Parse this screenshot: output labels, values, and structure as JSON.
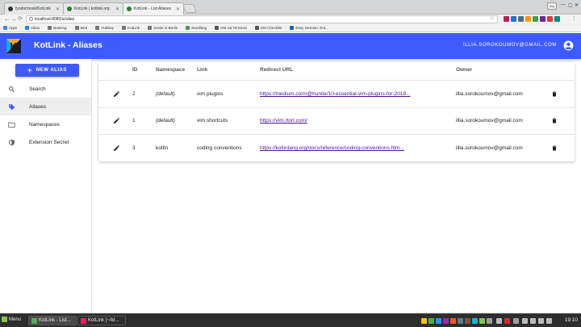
{
  "browser": {
    "tabs": [
      {
        "title": "fyodormosk/KotLink"
      },
      {
        "title": "KotLink | kotlink.org"
      },
      {
        "title": "KotLink - List Aliases"
      }
    ],
    "url": "localhost:8080/ui/alias",
    "user_chip": "Illia",
    "bookmarks": [
      {
        "label": "Apps"
      },
      {
        "label": "Inbox"
      },
      {
        "label": "Banking"
      },
      {
        "label": "Med"
      },
      {
        "label": "Yubikey"
      },
      {
        "label": "KotLink"
      },
      {
        "label": "Sextie in Berlin"
      },
      {
        "label": "Seedlang"
      },
      {
        "label": "GM via Terminal"
      },
      {
        "label": "GM Checklist"
      },
      {
        "label": "Easy German: Ent..."
      }
    ]
  },
  "app": {
    "title": "KotLink - Aliases",
    "user_email": "ILLIA.SOROKOUMOV@GMAIL.COM",
    "new_alias_label": "NEW ALIAS",
    "nav": [
      {
        "label": "Search",
        "icon": "search-icon"
      },
      {
        "label": "Aliases",
        "icon": "label-icon"
      },
      {
        "label": "Namespaces",
        "icon": "folder-icon"
      },
      {
        "label": "Extension Secret",
        "icon": "security-icon"
      }
    ],
    "accent_color": "#3d5afe"
  },
  "table": {
    "columns": {
      "id": "ID",
      "namespace": "Namespace",
      "link": "Link",
      "redirect": "Redirect URL",
      "owner": "Owner"
    },
    "rows": [
      {
        "id": "2",
        "namespace": "(default)",
        "link": "vim plugins",
        "redirect": "https://medium.com/@huntie/10-essential-vim-plugins-for-2018...",
        "owner": "illia.sorokoumov@gmail.com"
      },
      {
        "id": "1",
        "namespace": "(default)",
        "link": "vim shortcuts",
        "redirect": "https://vim.rtorr.com/",
        "owner": "illia.sorokoumov@gmail.com"
      },
      {
        "id": "3",
        "namespace": "kotlin",
        "link": "coding conventions",
        "redirect": "https://kotlinlang.org/docs/reference/coding-conventions.htm...",
        "owner": "illia.sorokoumov@gmail.com"
      }
    ]
  },
  "taskbar": {
    "menu_label": "Menu",
    "windows": [
      {
        "label": "KotLink - List..."
      },
      {
        "label": "KotLink [~/Id..."
      }
    ],
    "clock": "19:10"
  }
}
